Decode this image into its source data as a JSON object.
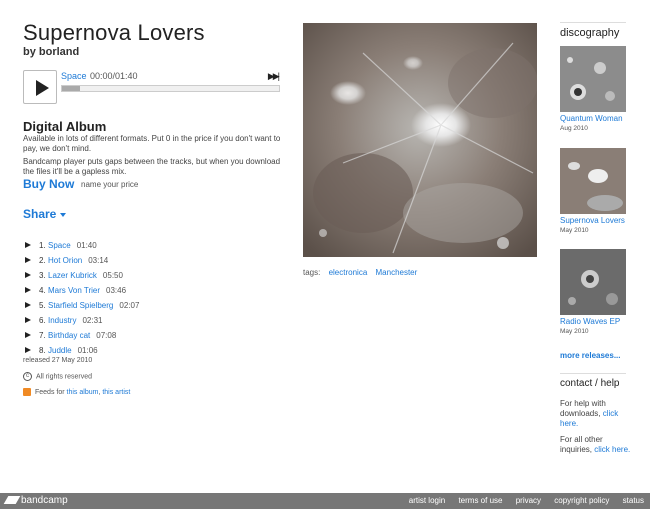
{
  "album": {
    "title": "Supernova Lovers",
    "by": "by borland"
  },
  "player": {
    "track": "Space",
    "time": "00:00/01:40",
    "next_icon": "next-track-icon",
    "progress": 0
  },
  "digital": {
    "heading": "Digital Album",
    "desc1": "Available in lots of different formats. Put 0 in the price if you don't want to pay, we don't mind.",
    "desc2": "Bandcamp player puts gaps between the tracks, but when you download the files it'll be a gapless mix.",
    "buy_now": "Buy Now",
    "name_price": "name your price"
  },
  "share": "Share",
  "tracks": [
    {
      "num": "1.",
      "title": "Space",
      "duration": "01:40"
    },
    {
      "num": "2.",
      "title": "Hot Orion",
      "duration": "03:14"
    },
    {
      "num": "3.",
      "title": "Lazer Kubrick",
      "duration": "05:50"
    },
    {
      "num": "4.",
      "title": "Mars Von Trier",
      "duration": "03:46"
    },
    {
      "num": "5.",
      "title": "Starfield Spielberg",
      "duration": "02:07"
    },
    {
      "num": "6.",
      "title": "Industry",
      "duration": "02:31"
    },
    {
      "num": "7.",
      "title": "Birthday cat",
      "duration": "07:08"
    },
    {
      "num": "8.",
      "title": "Juddle",
      "duration": "01:06"
    }
  ],
  "released": "released 27 May 2010",
  "rights": "All rights reserved",
  "feeds": {
    "prefix": "Feeds for",
    "album": "this album",
    "sep": ",",
    "artist": "this artist"
  },
  "tags": {
    "label": "tags:",
    "items": [
      "electronica",
      "Manchester"
    ]
  },
  "discography": {
    "heading": "discography",
    "items": [
      {
        "title": "Quantum Woman",
        "date": "Aug 2010"
      },
      {
        "title": "Supernova Lovers",
        "date": "May 2010"
      },
      {
        "title": "Radio Waves EP",
        "date": "May 2010"
      }
    ],
    "more": "more releases..."
  },
  "contact": {
    "heading": "contact / help",
    "help1_text": "For help with downloads,",
    "help1_link": "click here.",
    "help2_text": "For all other inquiries,",
    "help2_link": "click here."
  },
  "footer": {
    "logo": "bandcamp",
    "links": [
      "artist login",
      "terms of use",
      "privacy",
      "copyright policy",
      "status"
    ]
  },
  "colors": {
    "link": "#1e7ad6",
    "footer": "#777777",
    "rss": "#f08a24"
  }
}
